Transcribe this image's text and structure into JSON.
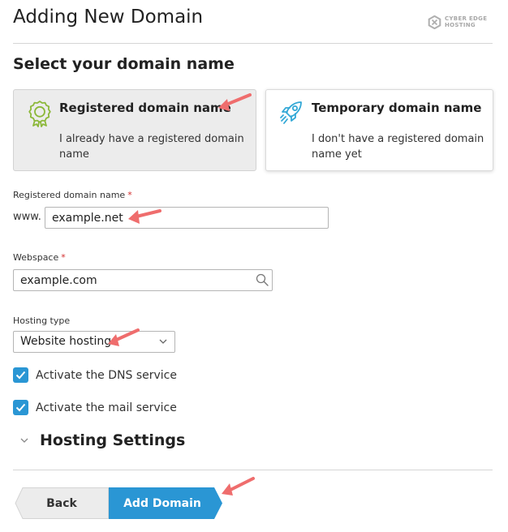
{
  "page": {
    "title": "Adding New Domain",
    "section_title": "Select your domain name"
  },
  "logo": {
    "line1": "CYBER EDGE",
    "line2": "HOSTING"
  },
  "options": [
    {
      "title": "Registered domain name",
      "description": "I already have a registered domain name",
      "selected": true,
      "icon": "badge-icon"
    },
    {
      "title": "Temporary domain name",
      "description": "I don't have a registered domain name yet",
      "selected": false,
      "icon": "rocket-icon"
    }
  ],
  "domain_field": {
    "label": "Registered domain name",
    "required_mark": "*",
    "prefix": "www.",
    "value": "example.net"
  },
  "webspace_field": {
    "label": "Webspace",
    "required_mark": "*",
    "value": "example.com"
  },
  "hosting_type": {
    "label": "Hosting type",
    "selected": "Website hosting"
  },
  "checkboxes": [
    {
      "label": "Activate the DNS service",
      "checked": true
    },
    {
      "label": "Activate the mail service",
      "checked": true
    }
  ],
  "hosting_settings": {
    "title": "Hosting Settings"
  },
  "buttons": {
    "back": "Back",
    "add_domain": "Add Domain"
  },
  "colors": {
    "primary": "#2a96d4",
    "required": "#d32c2c",
    "annotation_arrow": "#ef6d6d",
    "badge_green": "#8cb83a",
    "rocket_blue": "#33a8d6"
  }
}
